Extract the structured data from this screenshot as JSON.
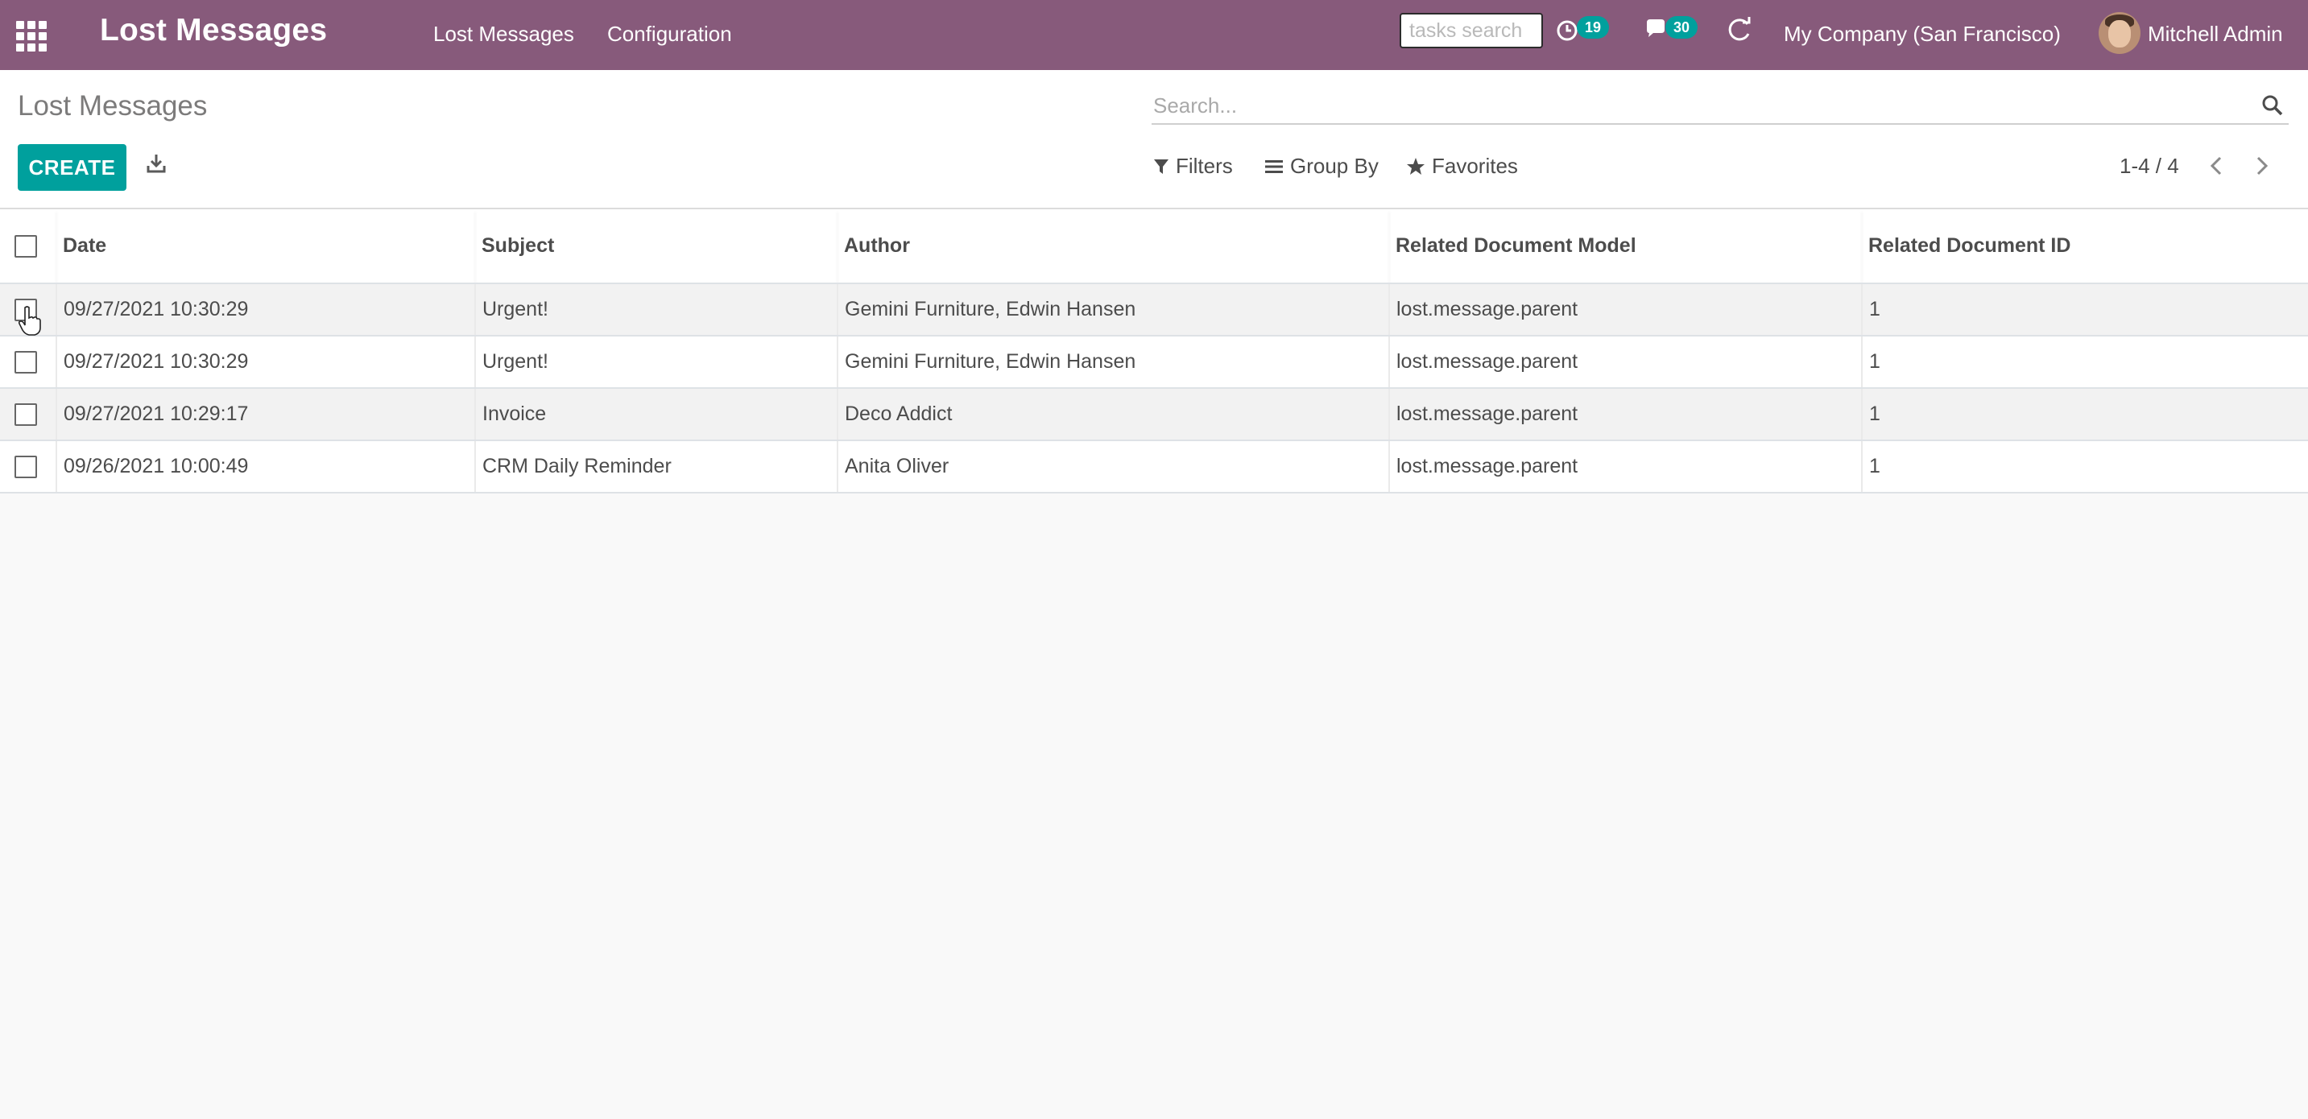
{
  "navbar": {
    "apps_icon": "apps-grid-icon",
    "brand": "Lost Messages",
    "menu": [
      "Lost Messages",
      "Configuration"
    ],
    "tasks_search_placeholder": "tasks search",
    "activity_count": "19",
    "messages_count": "30",
    "company": "My Company (San Francisco)",
    "user": "Mitchell Admin",
    "colors": {
      "navbar": "#875a7b",
      "badge": "#00a09d"
    }
  },
  "control_panel": {
    "breadcrumb": "Lost Messages",
    "create_label": "CREATE",
    "search_placeholder": "Search...",
    "filters_label": "Filters",
    "groupby_label": "Group By",
    "favorites_label": "Favorites",
    "pager": "1-4 / 4",
    "colors": {
      "primary": "#00a09d"
    }
  },
  "table": {
    "headers": [
      "Date",
      "Subject",
      "Author",
      "Related Document Model",
      "Related Document ID"
    ],
    "rows": [
      [
        "09/27/2021 10:30:29",
        "Urgent!",
        "Gemini Furniture, Edwin Hansen",
        "lost.message.parent",
        "1"
      ],
      [
        "09/27/2021 10:30:29",
        "Urgent!",
        "Gemini Furniture, Edwin Hansen",
        "lost.message.parent",
        "1"
      ],
      [
        "09/27/2021 10:29:17",
        "Invoice",
        "Deco Addict",
        "lost.message.parent",
        "1"
      ],
      [
        "09/26/2021 10:00:49",
        "CRM Daily Reminder",
        "Anita Oliver",
        "lost.message.parent",
        "1"
      ]
    ]
  }
}
